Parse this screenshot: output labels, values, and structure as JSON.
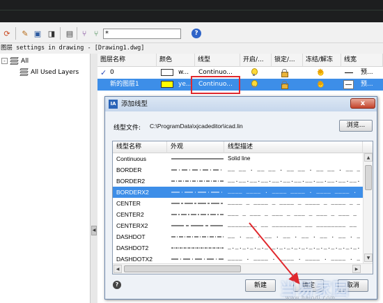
{
  "toolbar": {
    "filter_value": "*",
    "help_label": "?"
  },
  "status_text": "图层 settings in drawing - [Drawing1.dwg]",
  "tree": {
    "root_label": "All",
    "child_label": "All Used Layers",
    "expander": "-"
  },
  "layer_grid": {
    "columns": [
      "图层名称",
      "颜色",
      "线型",
      "开启/...",
      "锁定/...",
      "冻结/解冻",
      "线宽"
    ],
    "rows": [
      {
        "current_mark": "✓",
        "name": "0",
        "color_name": "w...",
        "color_hex": "#ffffff",
        "linetype": "Continuo...",
        "lineweight": "预..."
      },
      {
        "current_mark": "",
        "name": "新的图层1",
        "color_name": "ye...",
        "color_hex": "#ffff00",
        "linetype": "Continuo...",
        "lineweight": "预..."
      }
    ]
  },
  "dialog": {
    "title": "添加线型",
    "icon_label": "IA",
    "close_label": "x",
    "file_label": "线型文件:",
    "file_path": "C:\\ProgramData\\xjcadeditor\\icad.lin",
    "browse_label": "浏览...",
    "list_columns": [
      "线型名称",
      "外观",
      "线型描述"
    ],
    "linetypes": [
      {
        "name": "Continuous",
        "desc": "Solid line",
        "pattern": "solid"
      },
      {
        "name": "BORDER",
        "desc": "__ __ . __ __ . __ __ . __ __ . __ __ .",
        "pattern": "border"
      },
      {
        "name": "BORDER2",
        "desc": "__.__.__.__.__.__.__.__.__.__.__.__.__.",
        "pattern": "border2"
      },
      {
        "name": "BORDERX2",
        "desc": "____ ____ . ____ ____ . ____ ____ . ____",
        "pattern": "borderx2"
      },
      {
        "name": "CENTER",
        "desc": "____ _ ____ _ ____ _ ____ _ ____ _ ____",
        "pattern": "center"
      },
      {
        "name": "CENTER2",
        "desc": "___ _ ___ _ ___ _ ___ _ ___ _ ___ _ ___",
        "pattern": "center2"
      },
      {
        "name": "CENTERX2",
        "desc": "________ __ ________ __ ________ __ ____",
        "pattern": "centerx2"
      },
      {
        "name": "DASHDOT",
        "desc": "__ . __ . __ . __ . __ . __ . __ . __ .",
        "pattern": "dashdot"
      },
      {
        "name": "DASHDOT2",
        "desc": "_._._._._._._._._._._._._._._._._._._.",
        "pattern": "dashdot2"
      },
      {
        "name": "DASHDOTX2",
        "desc": "____ . ____ . ____ . ____ . ____ . ____",
        "pattern": "dashdotx2"
      }
    ],
    "selected_index": 3,
    "help_label": "?",
    "new_label": "新建",
    "ok_label": "确定",
    "cancel_label": "取消"
  },
  "watermark": {
    "main": "当易家园",
    "sub": "www.haiodi.com"
  },
  "colors": {
    "selection": "#3d8ee8",
    "highlight_box": "#e0282d",
    "arrow": "#e0282d",
    "dialog_border": "#6d88ad"
  }
}
